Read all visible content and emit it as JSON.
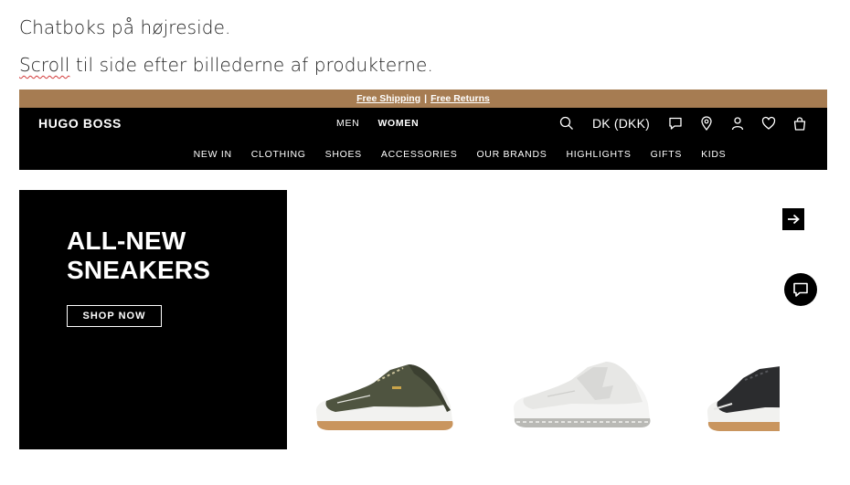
{
  "notes": {
    "line1": "Chatboks på højreside.",
    "line2_word": "Scroll",
    "line2_rest": " til side efter billederne af produkterne."
  },
  "promo": {
    "free_shipping": "Free Shipping",
    "separator": "|",
    "free_returns": "Free Returns",
    "color": "#a67c52"
  },
  "header": {
    "brand": "HUGO BOSS",
    "gender": [
      "MEN",
      "WOMEN"
    ],
    "currency": "DK (DKK)",
    "icons": [
      "search-icon",
      "chat-icon",
      "location-pin-icon",
      "account-icon",
      "wishlist-heart-icon",
      "shopping-bag-icon"
    ],
    "categories": [
      "NEW IN",
      "CLOTHING",
      "SHOES",
      "ACCESSORIES",
      "OUR BRANDS",
      "HIGHLIGHTS",
      "GIFTS",
      "KIDS"
    ]
  },
  "hero": {
    "title_line1": "ALL-NEW",
    "title_line2": "SNEAKERS",
    "cta": "SHOP NOW"
  },
  "carousel": {
    "next_icon": "arrow-right-icon",
    "chat_icon": "chat-bubble-icon"
  }
}
